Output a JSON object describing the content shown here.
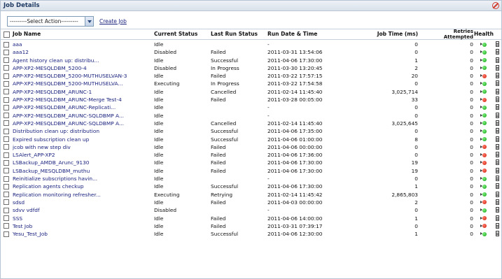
{
  "panel": {
    "title": "Job Details"
  },
  "toolbar": {
    "select_value": "---------Select Action---------",
    "create_job": "Create Job"
  },
  "columns": {
    "job_name": "Job Name",
    "current_status": "Current Status",
    "last_run_status": "Last Run Status",
    "run_date": "Run Date & Time",
    "job_time": "Job Time (ms)",
    "retries_1": "Retries",
    "retries_2": "Attempted",
    "health": "Health"
  },
  "rows": [
    {
      "name": "aaa",
      "status": "Idle",
      "last": "",
      "date": "-",
      "time": "0",
      "retries": "0",
      "health": "green"
    },
    {
      "name": "aaa12",
      "status": "Disabled",
      "last": "Failed",
      "date": "2011-03-31 13:54:06",
      "time": "0",
      "retries": "0",
      "health": "green"
    },
    {
      "name": "Agent history clean up: distribu...",
      "status": "Idle",
      "last": "Successful",
      "date": "2011-04-06 17:30:00",
      "time": "1",
      "retries": "0",
      "health": "green"
    },
    {
      "name": "APP-XP2-MESQLDBM_5200-4",
      "status": "Disabled",
      "last": "In Progress",
      "date": "2011-03-30 13:20:45",
      "time": "2",
      "retries": "0",
      "health": "green"
    },
    {
      "name": "APP-XP2-MESQLDBM_5200-MUTHUSELVAN-3",
      "status": "Idle",
      "last": "Failed",
      "date": "2011-03-22 17:57:15",
      "time": "20",
      "retries": "0",
      "health": "red"
    },
    {
      "name": "APP-XP2-MESQLDBM_5200-MUTHUSELVA...",
      "status": "Executing",
      "last": "In Progress",
      "date": "2011-03-22 17:54:58",
      "time": "0",
      "retries": "0",
      "health": "green"
    },
    {
      "name": "APP-XP2-MESQLDBM_ARUNC-1",
      "status": "Idle",
      "last": "Cancelled",
      "date": "2011-02-14 11:45:40",
      "time": "3,025,714",
      "retries": "0",
      "health": "green"
    },
    {
      "name": "APP-XP2-MESQLDBM_ARUNC-Merge Test-4",
      "status": "Idle",
      "last": "Failed",
      "date": "2011-03-28 00:05:00",
      "time": "33",
      "retries": "0",
      "health": "red"
    },
    {
      "name": "APP-XP2-MESQLDBM_ARUNC-Replicati...",
      "status": "Idle",
      "last": "",
      "date": "-",
      "time": "0",
      "retries": "0",
      "health": "green"
    },
    {
      "name": "APP-XP2-MESQLDBM_ARUNC-SQLDBMP A...",
      "status": "Idle",
      "last": "",
      "date": "-",
      "time": "0",
      "retries": "0",
      "health": "green"
    },
    {
      "name": "APP-XP2-MESQLDBM_ARUNC-SQLDBMP A...",
      "status": "Idle",
      "last": "Cancelled",
      "date": "2011-02-14 11:45:40",
      "time": "3,025,645",
      "retries": "0",
      "health": "green"
    },
    {
      "name": "Distribution clean up: distribution",
      "status": "Idle",
      "last": "Successful",
      "date": "2011-04-06 17:35:00",
      "time": "0",
      "retries": "0",
      "health": "green"
    },
    {
      "name": "Expired subscription clean up",
      "status": "Idle",
      "last": "Successful",
      "date": "2011-04-06 01:00:00",
      "time": "8",
      "retries": "0",
      "health": "green"
    },
    {
      "name": "jcob with new step div",
      "status": "Idle",
      "last": "Failed",
      "date": "2011-04-06 00:00:00",
      "time": "0",
      "retries": "0",
      "health": "red"
    },
    {
      "name": "LSAlert_APP-XP2",
      "status": "Idle",
      "last": "Failed",
      "date": "2011-04-06 17:36:00",
      "time": "0",
      "retries": "0",
      "health": "red"
    },
    {
      "name": "LSBackup_AMDB_Arunc_9130",
      "status": "Idle",
      "last": "Failed",
      "date": "2011-04-06 17:30:00",
      "time": "19",
      "retries": "0",
      "health": "red"
    },
    {
      "name": "LSBackup_MESQLDBM_muthu",
      "status": "Idle",
      "last": "Failed",
      "date": "2011-04-06 17:30:00",
      "time": "19",
      "retries": "0",
      "health": "red"
    },
    {
      "name": "Reinitialize subscriptions havin...",
      "status": "Idle",
      "last": "",
      "date": "-",
      "time": "0",
      "retries": "0",
      "health": "green"
    },
    {
      "name": "Replication agents checkup",
      "status": "Idle",
      "last": "Successful",
      "date": "2011-04-06 17:30:00",
      "time": "1",
      "retries": "0",
      "health": "green"
    },
    {
      "name": "Replication monitoring refresher...",
      "status": "Executing",
      "last": "Retrying",
      "date": "2011-02-14 11:45:42",
      "time": "2,865,803",
      "retries": "0",
      "health": "green"
    },
    {
      "name": "sdsd",
      "status": "Idle",
      "last": "Failed",
      "date": "2011-04-03 00:00:00",
      "time": "2",
      "retries": "0",
      "health": "red"
    },
    {
      "name": "sdvv vdfdf",
      "status": "Disabled",
      "last": "",
      "date": "-",
      "time": "0",
      "retries": "0",
      "health": "green"
    },
    {
      "name": "SSS",
      "status": "Idle",
      "last": "Failed",
      "date": "2011-04-06 14:00:00",
      "time": "1",
      "retries": "0",
      "health": "red"
    },
    {
      "name": "Test Job",
      "status": "Idle",
      "last": "Failed",
      "date": "2011-03-31 07:39:17",
      "time": "0",
      "retries": "0",
      "health": "red"
    },
    {
      "name": "Yesu_Test_Job",
      "status": "Idle",
      "last": "Successful",
      "date": "2011-04-06 12:30:00",
      "time": "1",
      "retries": "0",
      "health": "green"
    }
  ],
  "colors": {
    "title_text": "#1f3b63",
    "link": "#1a237e",
    "healthy": "#10a010",
    "unhealthy": "#d0200c"
  },
  "icons": {
    "close": "close-circle-icon",
    "health_ok": "green-dot-icon",
    "health_bad": "red-dot-icon",
    "details": "document-icon"
  }
}
